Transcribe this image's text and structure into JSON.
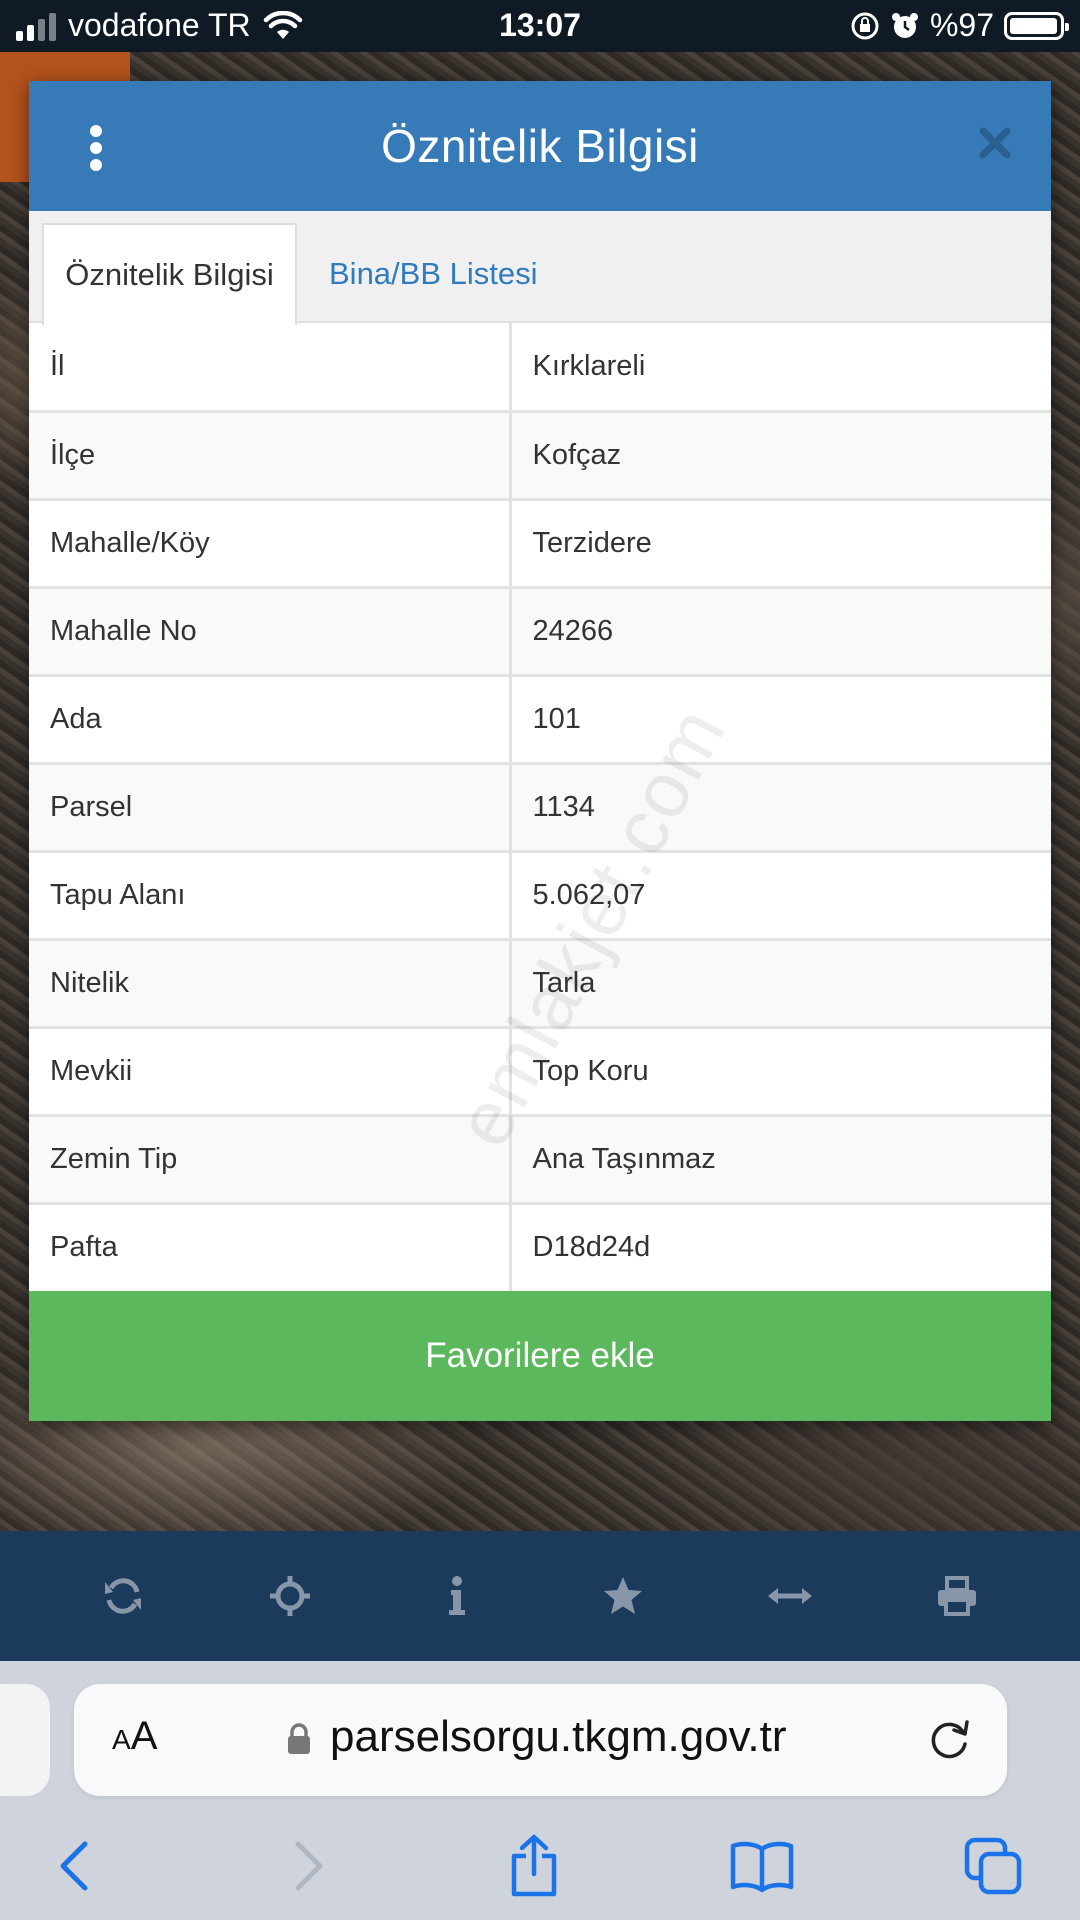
{
  "status_bar": {
    "carrier": "vodafone TR",
    "time": "13:07",
    "battery": "%97"
  },
  "modal": {
    "title": "Öznitelik Bilgisi",
    "tabs": [
      {
        "label": "Öznitelik Bilgisi",
        "active": true
      },
      {
        "label": "Bina/BB Listesi",
        "active": false
      }
    ],
    "rows": [
      {
        "key": "İl",
        "value": "Kırklareli"
      },
      {
        "key": "İlçe",
        "value": "Kofçaz"
      },
      {
        "key": "Mahalle/Köy",
        "value": "Terzidere"
      },
      {
        "key": "Mahalle No",
        "value": "24266"
      },
      {
        "key": "Ada",
        "value": "101"
      },
      {
        "key": "Parsel",
        "value": "1134"
      },
      {
        "key": "Tapu Alanı",
        "value": "5.062,07"
      },
      {
        "key": "Nitelik",
        "value": "Tarla"
      },
      {
        "key": "Mevkii",
        "value": "Top Koru"
      },
      {
        "key": "Zemin Tip",
        "value": "Ana Taşınmaz"
      },
      {
        "key": "Pafta",
        "value": "D18d24d"
      }
    ],
    "favorite_button": "Favorilere ekle",
    "watermark": "emlakjet.com"
  },
  "toolbar_icons": [
    "refresh-icon",
    "crosshair-icon",
    "info-icon",
    "star-icon",
    "measure-icon",
    "print-icon"
  ],
  "safari": {
    "aa_label": "AA",
    "url": "parselsorgu.tkgm.gov.tr"
  },
  "colors": {
    "header_blue": "#367ab8",
    "tab_link_blue": "#2f7bbf",
    "favorite_green": "#5cb85c",
    "toolbar_navy": "#1b3a5c",
    "safari_blue": "#1a73e8"
  }
}
